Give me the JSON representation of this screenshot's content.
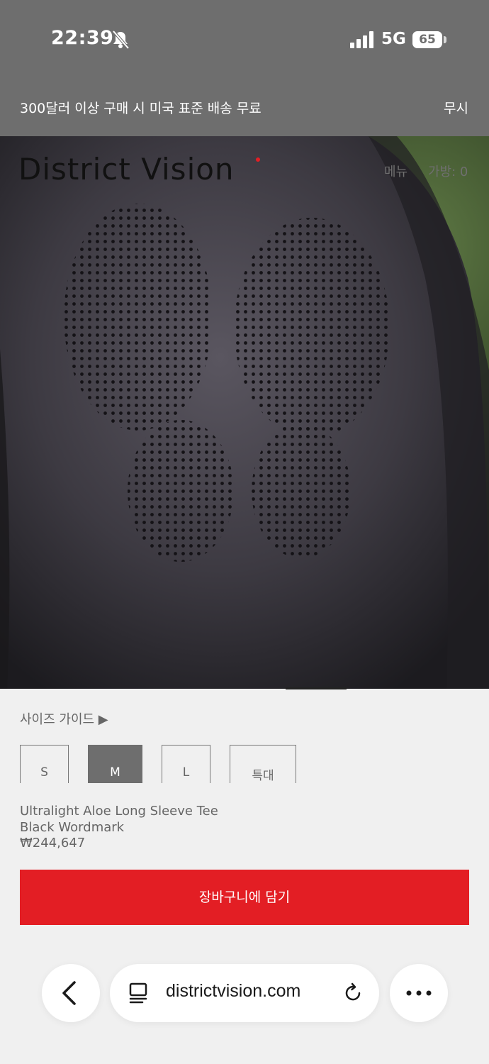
{
  "status_bar": {
    "time": "22:39",
    "network": "5G",
    "battery": "65",
    "icons": [
      "bell-slash-icon",
      "signal-icon",
      "battery-icon"
    ]
  },
  "promo": {
    "text": "300달러 이상 구매 시 미국 표준 배송 무료",
    "dismiss_label": "무시"
  },
  "header": {
    "logo": "District Vision",
    "menu_label": "메뉴",
    "bag_label": "가방: 0"
  },
  "product": {
    "size_guide_label": "사이즈 가이드 ▶",
    "sizes": [
      {
        "label": "S",
        "selected": false
      },
      {
        "label": "M",
        "selected": true
      },
      {
        "label": "L",
        "selected": false
      },
      {
        "label": "특대",
        "selected": false
      }
    ],
    "name": "Ultralight Aloe Long Sleeve Tee",
    "variant": "Black Wordmark",
    "price": "₩244,647",
    "add_to_cart_label": "장바구니에 담기"
  },
  "browser": {
    "url": "districtvision.com",
    "icons": [
      "chevron-left-icon",
      "tabs-icon",
      "reload-icon",
      "more-icon"
    ]
  },
  "colors": {
    "accent_red": "#e31e24",
    "banner_grey": "#6e6e6e",
    "page_bg": "#f0f0f0"
  }
}
